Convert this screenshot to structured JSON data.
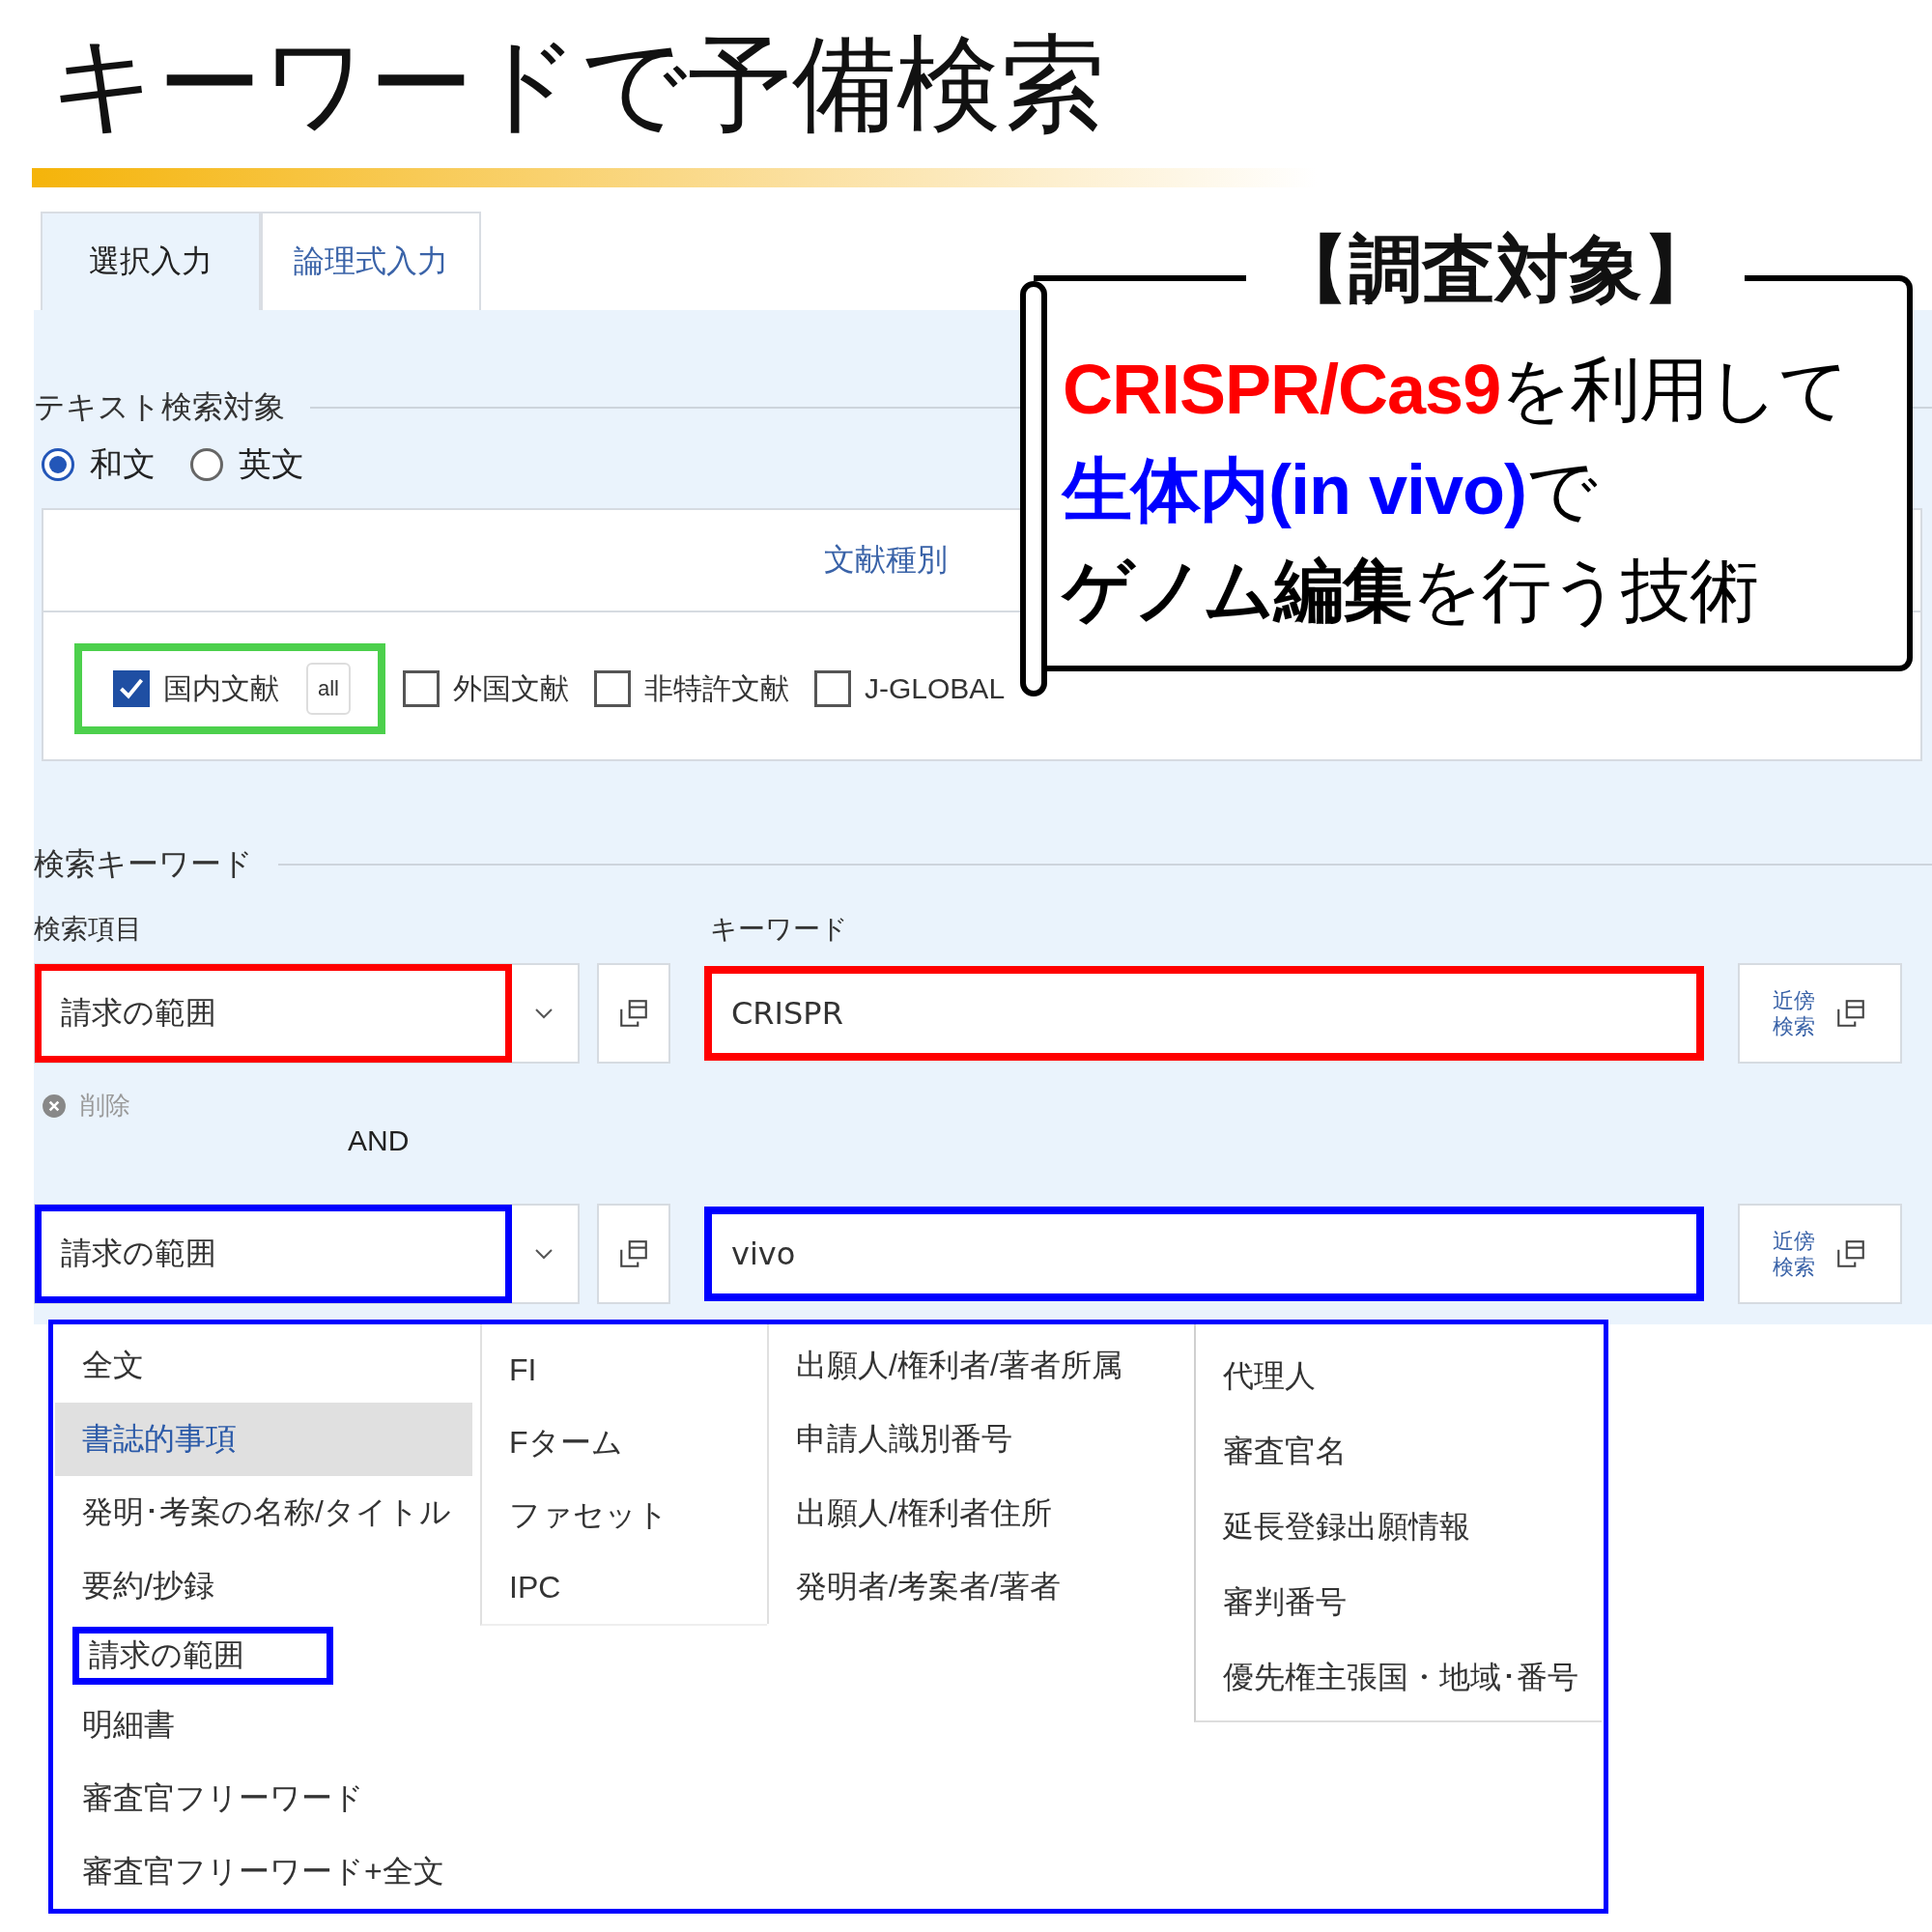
{
  "slide_title": "キーワードで予備検索",
  "tabs": [
    {
      "label": "選択入力",
      "selected": true
    },
    {
      "label": "論理式入力",
      "selected": false
    }
  ],
  "text_target": {
    "heading": "テキスト検索対象",
    "options": [
      {
        "label": "和文",
        "selected": true
      },
      {
        "label": "英文",
        "selected": false
      }
    ]
  },
  "document_types": {
    "heading": "文献種別",
    "items": [
      {
        "label": "国内文献",
        "checked": true,
        "badge": "all",
        "color": "#4cd04c"
      },
      {
        "label": "外国文献",
        "checked": false
      },
      {
        "label": "非特許文献",
        "checked": false
      },
      {
        "label": "J-GLOBAL",
        "checked": false
      }
    ]
  },
  "keywords": {
    "heading": "検索キーワード",
    "field_label": "検索項目",
    "keyword_label": "キーワード",
    "delete": "削除",
    "operator": "AND",
    "rows": [
      {
        "field": "請求の範囲",
        "keyword": "CRISPR",
        "proximity": "近傍検索",
        "color": "#ff0000"
      },
      {
        "field": "請求の範囲",
        "keyword": "vivo",
        "proximity": "近傍検索",
        "color": "#0000ff"
      }
    ]
  },
  "dropdown": {
    "columns": [
      [
        {
          "label": "全文",
          "selected": false
        },
        {
          "label": "書誌的事項",
          "selected": true
        },
        {
          "label": "発明･考案の名称/タイトル",
          "selected": false
        },
        {
          "label": "要約/抄録",
          "selected": false
        },
        {
          "label": "請求の範囲",
          "selected": false,
          "color": "#0000ff"
        },
        {
          "label": "明細書",
          "selected": false
        },
        {
          "label": "審査官フリーワード",
          "selected": false
        },
        {
          "label": "審査官フリーワード+全文",
          "selected": false
        }
      ],
      [
        {
          "label": "FI",
          "selected": false
        },
        {
          "label": "Fターム",
          "selected": false
        },
        {
          "label": "ファセット",
          "selected": false
        },
        {
          "label": "IPC",
          "selected": false
        }
      ],
      [
        {
          "label": "出願人/権利者/著者所属",
          "selected": false
        },
        {
          "label": "申請人識別番号",
          "selected": false
        },
        {
          "label": "出願人/権利者住所",
          "selected": false
        },
        {
          "label": "発明者/考案者/著者",
          "selected": false
        }
      ],
      [
        {
          "label": "代理人",
          "selected": false
        },
        {
          "label": "審査官名",
          "selected": false
        },
        {
          "label": "延長登録出願情報",
          "selected": false
        },
        {
          "label": "審判番号",
          "selected": false
        },
        {
          "label": "優先権主張国・地域･番号",
          "selected": false
        }
      ]
    ]
  },
  "callout": {
    "heading": "【調査対象】",
    "lines": [
      [
        {
          "text": "CRISPR/Cas9",
          "color": "#ff0000",
          "bold": true
        },
        {
          "text": "を利用して",
          "color": "#000000",
          "bold": false
        }
      ],
      [
        {
          "text": "生体内(in vivo)",
          "color": "#0000ff",
          "bold": true
        },
        {
          "text": "で",
          "color": "#000000",
          "bold": false
        }
      ],
      [
        {
          "text": "ゲノム編集",
          "color": "#000000",
          "bold": true
        },
        {
          "text": "を行う技術",
          "color": "#000000",
          "bold": false
        }
      ]
    ]
  }
}
